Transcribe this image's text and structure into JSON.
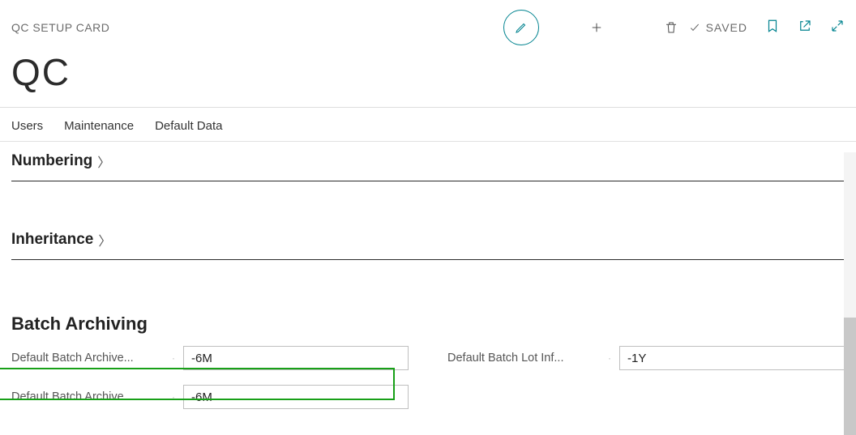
{
  "header": {
    "card_type": "QC SETUP CARD",
    "saved_label": "SAVED"
  },
  "page_title": "QC",
  "tabs": [
    "Users",
    "Maintenance",
    "Default Data"
  ],
  "sections": {
    "numbering": "Numbering",
    "inheritance": "Inheritance",
    "batch_archiving": "Batch Archiving"
  },
  "fields": {
    "archive1": {
      "label": "Default Batch Archive...",
      "value": "-6M"
    },
    "archive2": {
      "label": "Default Batch Archive...",
      "value": "-6M"
    },
    "lotinfo": {
      "label": "Default Batch Lot Inf...",
      "value": "-1Y"
    }
  }
}
